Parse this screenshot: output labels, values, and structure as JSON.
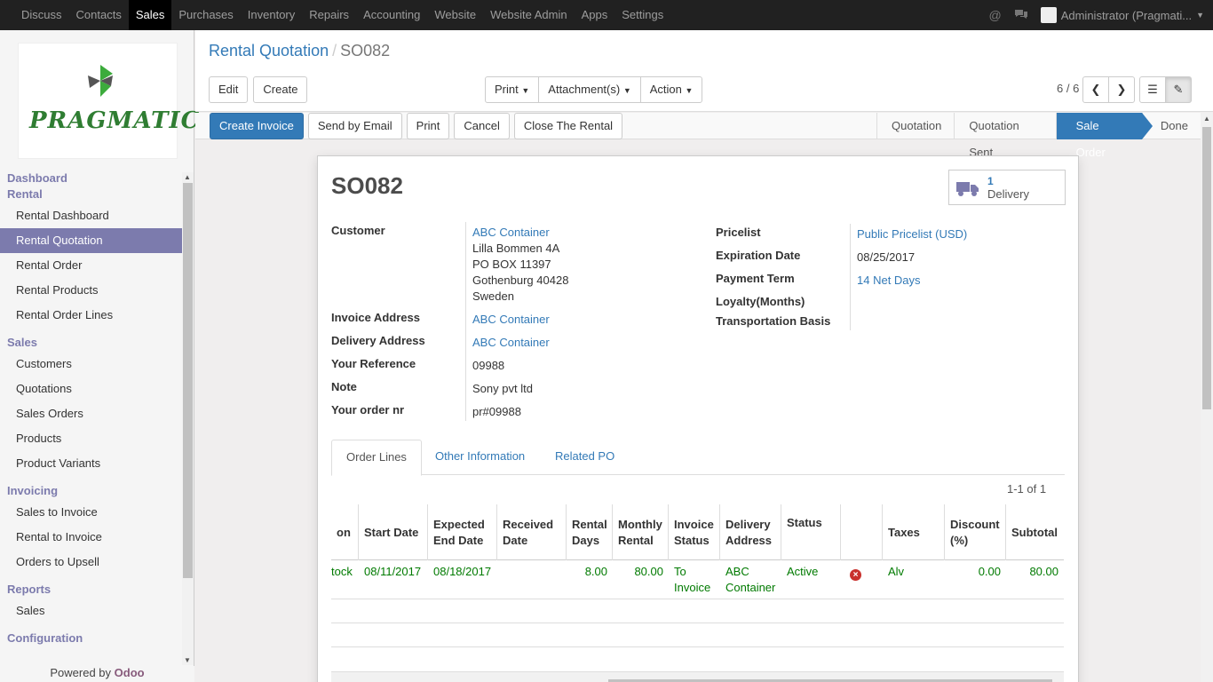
{
  "topbar": {
    "menu": [
      "Discuss",
      "Contacts",
      "Sales",
      "Purchases",
      "Inventory",
      "Repairs",
      "Accounting",
      "Website",
      "Website Admin",
      "Apps",
      "Settings"
    ],
    "active_menu": "Sales",
    "user": "Administrator (Pragmati...",
    "icons": [
      "at-icon",
      "chat-icon",
      "chevron-down-icon"
    ]
  },
  "sidebar": {
    "logo_text": "PRAGMATIC",
    "sections": [
      {
        "header": "Dashboard",
        "items": []
      },
      {
        "header": "Rental",
        "items": [
          "Rental Dashboard",
          "Rental Quotation",
          "Rental Order",
          "Rental Products",
          "Rental Order Lines"
        ]
      },
      {
        "header": "Sales",
        "items": [
          "Customers",
          "Quotations",
          "Sales Orders",
          "Products",
          "Product Variants"
        ]
      },
      {
        "header": "Invoicing",
        "items": [
          "Sales to Invoice",
          "Rental to Invoice",
          "Orders to Upsell"
        ]
      },
      {
        "header": "Reports",
        "items": [
          "Sales"
        ]
      },
      {
        "header": "Configuration",
        "items": []
      }
    ],
    "active_item": "Rental Quotation",
    "powered_by": "Powered by",
    "powered_brand": "Odoo"
  },
  "control_panel": {
    "breadcrumb_parent": "Rental Quotation",
    "breadcrumb_sep": "/",
    "breadcrumb_current": "SO082",
    "edit_label": "Edit",
    "create_label": "Create",
    "print_label": "Print",
    "attachments_label": "Attachment(s)",
    "action_label": "Action",
    "pager": "6 / 6"
  },
  "statusbar": {
    "actions": [
      "Create Invoice",
      "Send by Email",
      "Print",
      "Cancel",
      "Close The Rental"
    ],
    "stages": [
      "Quotation",
      "Quotation Sent",
      "Sale Order",
      "Done"
    ],
    "active_stage": "Sale Order"
  },
  "record": {
    "name": "SO082",
    "smart_button": {
      "count": "1",
      "label": "Delivery"
    },
    "customer_label": "Customer",
    "customer_name": "ABC Container",
    "customer_address": [
      "Lilla Bommen 4A",
      "PO BOX 11397",
      "Gothenburg 40428",
      "Sweden"
    ],
    "invoice_address_label": "Invoice Address",
    "invoice_address": "ABC Container",
    "delivery_address_label": "Delivery Address",
    "delivery_address": "ABC Container",
    "your_reference_label": "Your Reference",
    "your_reference": "09988",
    "note_label": "Note",
    "note": "Sony pvt ltd",
    "your_order_label": "Your order nr",
    "your_order": "pr#09988",
    "pricelist_label": "Pricelist",
    "pricelist": "Public Pricelist (USD)",
    "expiration_label": "Expiration Date",
    "expiration": "08/25/2017",
    "payment_term_label": "Payment Term",
    "payment_term": "14 Net Days",
    "loyalty_label": "Loyalty(Months)",
    "transport_label": "Transportation Basis"
  },
  "tabs": [
    "Order Lines",
    "Other Information",
    "Related PO"
  ],
  "order_lines": {
    "pager": "1-1 of 1",
    "columns": [
      "on",
      "Start Date",
      "Expected End Date",
      "Received Date",
      "Rental Days",
      "Monthly Rental",
      "Invoice Status",
      "Delivery Address",
      "Status",
      "",
      "Taxes",
      "Discount (%)",
      "Subtotal"
    ],
    "rows": [
      [
        "tock",
        "08/11/2017",
        "08/18/2017",
        "",
        "8.00",
        "80.00",
        "To Invoice",
        "ABC Container",
        "Active",
        "",
        "Alv",
        "0.00",
        "80.00"
      ]
    ]
  }
}
